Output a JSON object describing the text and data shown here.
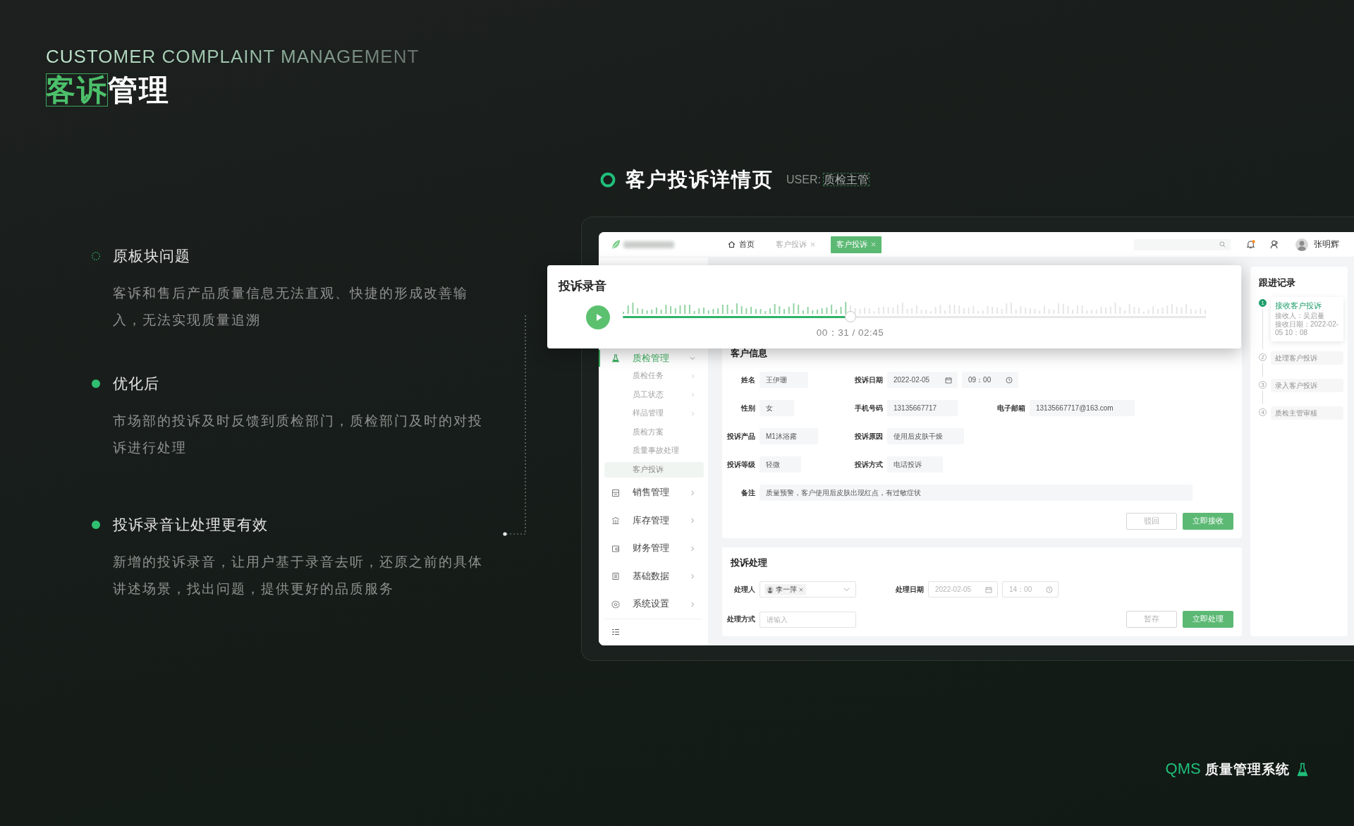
{
  "intro": {
    "subtitle": "CUSTOMER COMPLAINT MANAGEMENT",
    "title_highlight": "客诉",
    "title_rest": "管理"
  },
  "points": [
    {
      "kind": "before",
      "heading": "原板块问题",
      "text": "客诉和售后产品质量信息无法直观、快捷的形成改善输入，无法实现质量追溯"
    },
    {
      "kind": "after",
      "heading": "优化后",
      "text": "市场部的投诉及时反馈到质检部门，质检部门及时的对投诉进行处理"
    },
    {
      "kind": "after",
      "heading": "投诉录音让处理更有效",
      "text": "新增的投诉录音，让用户基于录音去听，还原之前的具体讲述场景，找出问题，提供更好的品质服务"
    }
  ],
  "screen": {
    "title": "客户投诉详情页",
    "user_label": "USER:",
    "user_role": "质检主管"
  },
  "app": {
    "tabs": [
      {
        "kind": "home",
        "label": "首页",
        "selected": false
      },
      {
        "kind": "closable",
        "label": "客户投诉",
        "selected": false
      },
      {
        "kind": "closable",
        "label": "客户投诉",
        "selected": true
      }
    ],
    "notification": true,
    "user_name": "张明辉",
    "menu": [
      {
        "label": "质检管理",
        "expanded": true,
        "selected": true,
        "children": [
          {
            "label": "质检任务",
            "submenu": true,
            "selected": false
          },
          {
            "label": "员工状态",
            "submenu": true,
            "selected": false
          },
          {
            "label": "样品管理",
            "submenu": true,
            "selected": false
          },
          {
            "label": "质检方案",
            "submenu": false,
            "selected": false
          },
          {
            "label": "质量事故处理",
            "submenu": false,
            "selected": false
          },
          {
            "label": "客户投诉",
            "submenu": false,
            "selected": true
          }
        ]
      },
      {
        "label": "销售管理",
        "expanded": false,
        "selected": false
      },
      {
        "label": "库存管理",
        "expanded": false,
        "selected": false
      },
      {
        "label": "财务管理",
        "expanded": false,
        "selected": false
      },
      {
        "label": "基础数据",
        "expanded": false,
        "selected": false
      },
      {
        "label": "系统设置",
        "expanded": false,
        "selected": false
      }
    ],
    "recording": {
      "title": "投诉录音",
      "level": 0.39,
      "time": "00：31 / 02:45"
    },
    "customer_info": {
      "title": "客户信息",
      "rows": [
        [
          {
            "kind": "text",
            "label": "姓名",
            "value": "王伊珊"
          },
          {
            "kind": "datetime",
            "label": "投诉日期",
            "date": "2022-02-05",
            "time": "09：00"
          }
        ],
        [
          {
            "kind": "text",
            "label": "性别",
            "value": "女"
          },
          {
            "kind": "text",
            "label": "手机号码",
            "value": "13135667717"
          },
          {
            "kind": "text",
            "label": "电子邮箱",
            "value": "13135667717@163.com"
          }
        ],
        [
          {
            "kind": "text",
            "label": "投诉产品",
            "value": "M1沐浴露"
          },
          {
            "kind": "text",
            "label": "投诉原因",
            "value": "使用后皮肤干燥"
          }
        ],
        [
          {
            "kind": "text",
            "label": "投诉等级",
            "value": "轻微"
          },
          {
            "kind": "text",
            "label": "投诉方式",
            "value": "电话投诉"
          }
        ],
        [
          {
            "kind": "note",
            "label": "备注",
            "value": "质量预警，客户使用后皮肤出现红点，有过敏症状"
          }
        ]
      ],
      "buttons": [
        {
          "kind": "secondary",
          "label": "驳回"
        },
        {
          "kind": "primary",
          "label": "立即接收"
        }
      ]
    },
    "handling": {
      "title": "投诉处理",
      "handler": {
        "label": "处理人",
        "tags": [
          "李一萍"
        ]
      },
      "date": {
        "label": "处理日期",
        "date_placeholder": "2022-02-05",
        "time_placeholder": "14：00"
      },
      "method": {
        "label": "处理方式",
        "placeholder": "请输入"
      },
      "buttons": [
        {
          "kind": "secondary",
          "label": "暂存"
        },
        {
          "kind": "primary",
          "label": "立即处理"
        }
      ]
    },
    "follow_up": {
      "title": "跟进记录",
      "steps": [
        {
          "number": "1",
          "title": "接收客户投诉",
          "active": true,
          "details": [
            "接收人：吴启蔓",
            "接收日期：2022-02-05 10：08"
          ]
        },
        {
          "number": "2",
          "title": "处理客户投诉",
          "active": false
        },
        {
          "number": "3",
          "title": "录入客户投诉",
          "active": false
        },
        {
          "number": "4",
          "title": "质检主管审核",
          "active": false
        }
      ]
    }
  },
  "brand": {
    "abbr": "QMS",
    "name": "质量管理系统"
  }
}
